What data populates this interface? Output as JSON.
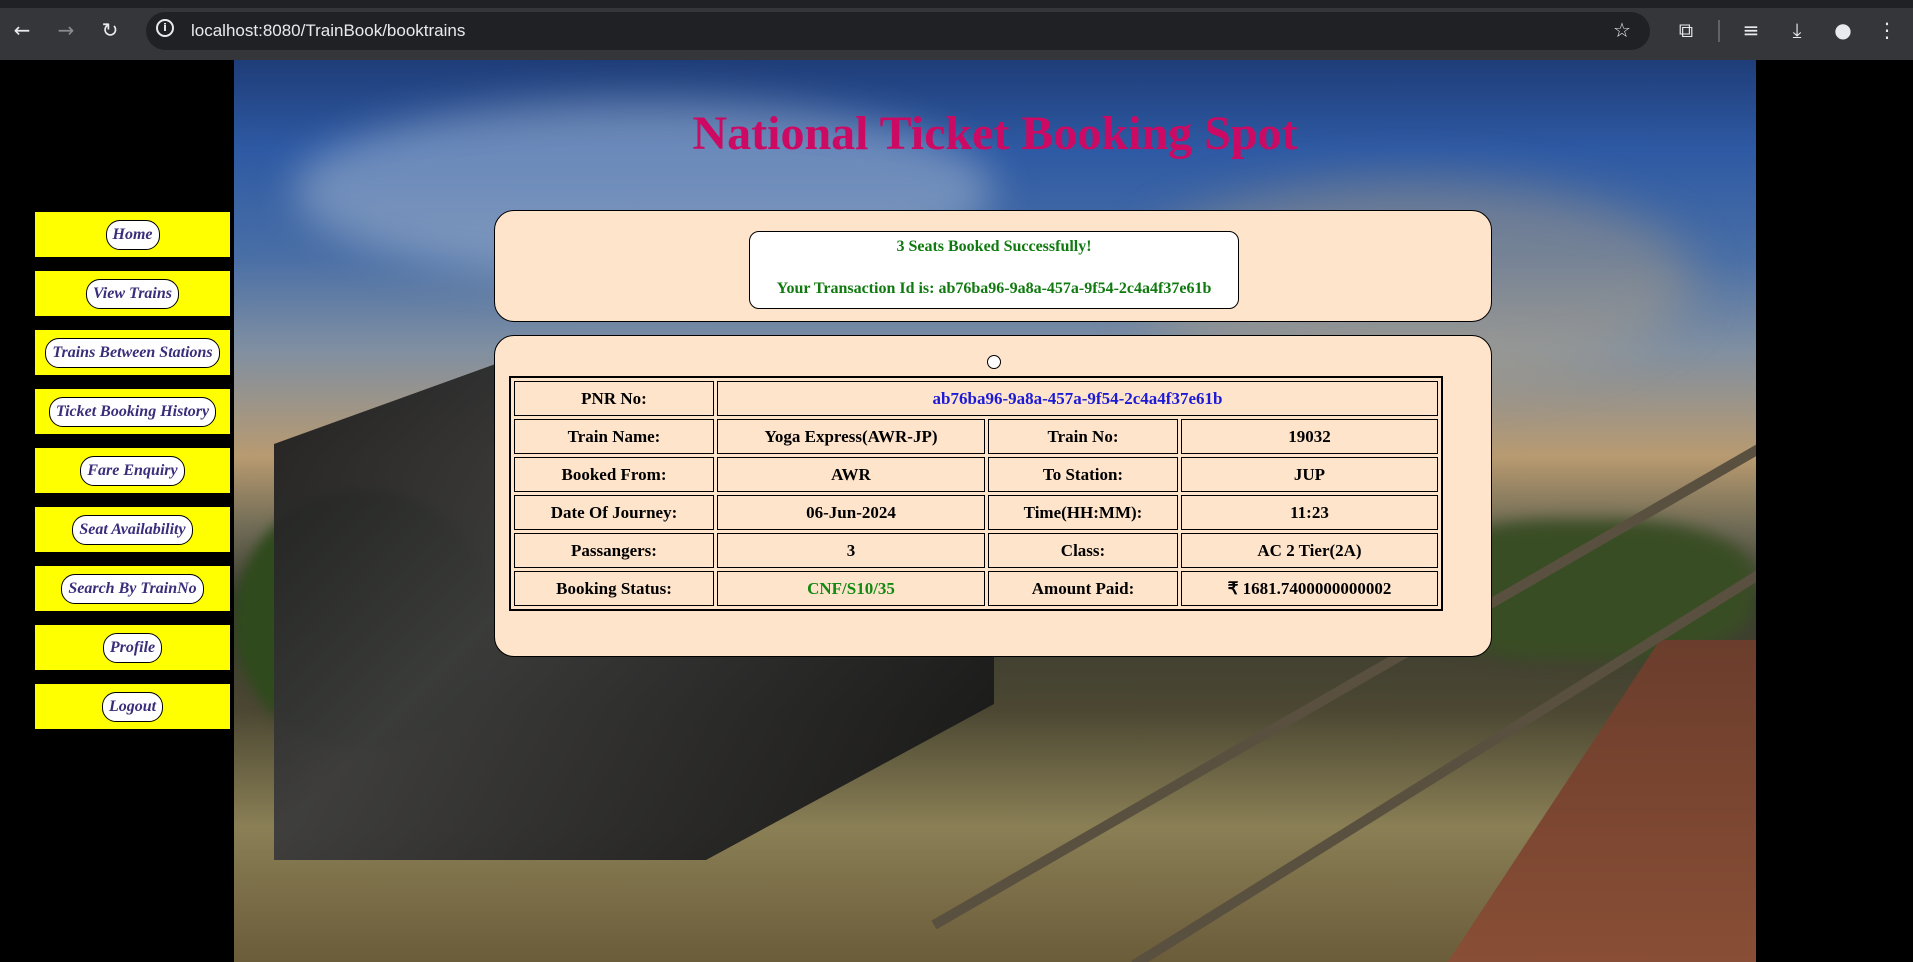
{
  "browser": {
    "url": "localhost:8080/TrainBook/booktrains"
  },
  "page": {
    "title": "National Ticket Booking Spot"
  },
  "sidebar": {
    "items": [
      {
        "label": "Home"
      },
      {
        "label": "View Trains"
      },
      {
        "label": "Trains Between Stations"
      },
      {
        "label": "Ticket Booking History"
      },
      {
        "label": "Fare Enquiry"
      },
      {
        "label": "Seat Availability"
      },
      {
        "label": "Search By TrainNo"
      },
      {
        "label": "Profile"
      },
      {
        "label": "Logout"
      }
    ]
  },
  "message": {
    "line1": "3 Seats Booked Successfully!",
    "line2": "Your Transaction Id is: ab76ba96-9a8a-457a-9f54-2c4a4f37e61b"
  },
  "ticket": {
    "pnr_label": "PNR No:",
    "pnr_value": "ab76ba96-9a8a-457a-9f54-2c4a4f37e61b",
    "train_name_label": "Train Name:",
    "train_name_value": "Yoga Express(AWR-JP)",
    "train_no_label": "Train No:",
    "train_no_value": "19032",
    "from_label": "Booked From:",
    "from_value": "AWR",
    "to_label": "To Station:",
    "to_value": "JUP",
    "date_label": "Date Of Journey:",
    "date_value": "06-Jun-2024",
    "time_label": "Time(HH:MM):",
    "time_value": "11:23",
    "passengers_label": "Passangers:",
    "passengers_value": "3",
    "class_label": "Class:",
    "class_value": "AC 2 Tier(2A)",
    "status_label": "Booking Status:",
    "status_value": "CNF/S10/35",
    "amount_label": "Amount Paid:",
    "amount_value": "₹ 1681.7400000000002"
  },
  "colors": {
    "title": "#cc0a63",
    "menu_bg": "#ffff00",
    "menu_text": "#3a2d7a",
    "panel_bg": "#ffe4cc",
    "success": "#107a10",
    "pnr": "#1b1bd6"
  },
  "icons": [
    "back-icon",
    "forward-icon",
    "reload-icon",
    "site-info-icon",
    "star-icon",
    "extensions-icon",
    "media-icon",
    "download-icon",
    "profile-icon",
    "menu-icon"
  ]
}
